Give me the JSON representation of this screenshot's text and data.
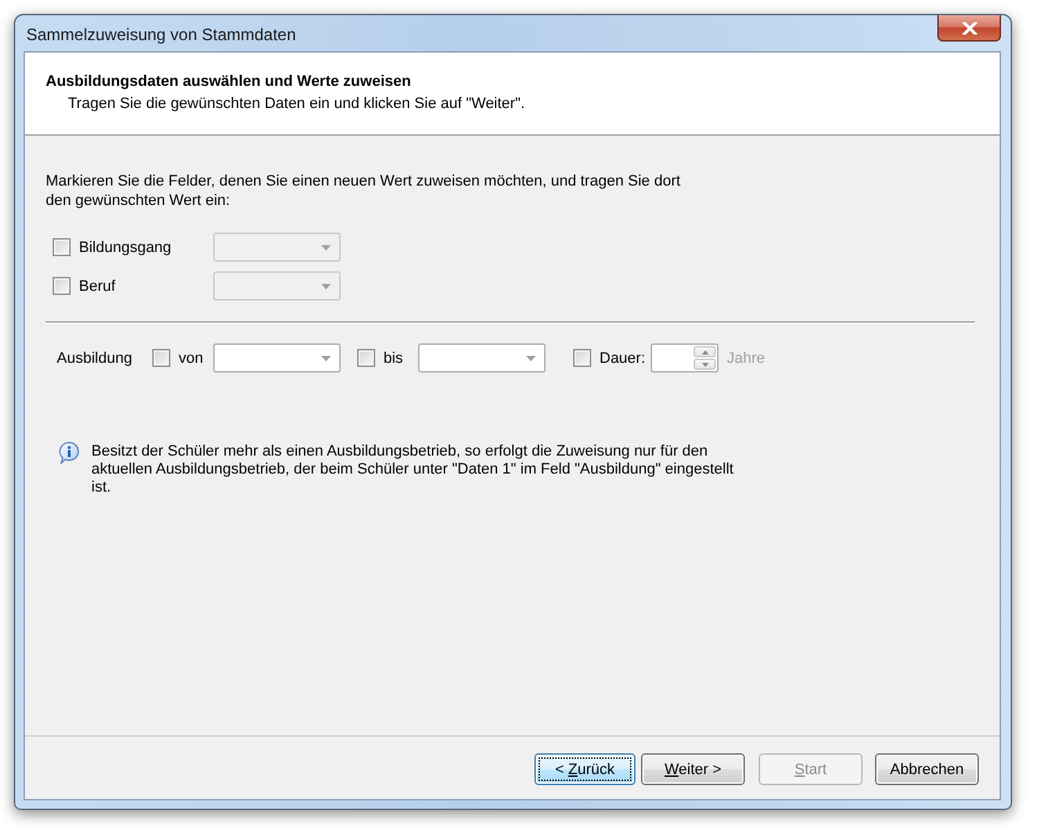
{
  "window": {
    "title": "Sammelzuweisung von Stammdaten"
  },
  "header": {
    "title": "Ausbildungsdaten auswählen und Werte zuweisen",
    "subtitle": "Tragen Sie die gewünschten Daten ein und klicken Sie auf \"Weiter\"."
  },
  "instructions": "Markieren Sie die Felder, denen Sie einen neuen Wert zuweisen möchten, und tragen Sie dort den gewünschten Wert ein:",
  "fields": [
    {
      "label": "Bildungsgang",
      "checked": false,
      "disabled": true
    },
    {
      "label": "Beruf",
      "checked": false,
      "disabled": true
    }
  ],
  "ausbildung": {
    "label": "Ausbildung",
    "items": [
      {
        "kind": "combo",
        "label": "von",
        "checked": false,
        "disabled": false
      },
      {
        "kind": "combo",
        "label": "bis",
        "checked": false,
        "disabled": false
      },
      {
        "kind": "spinner",
        "label": "Dauer:",
        "checked": false,
        "disabled": false,
        "unit": "Jahre"
      }
    ]
  },
  "info": "Besitzt der Schüler mehr als einen Ausbildungsbetrieb, so erfolgt die Zuweisung nur für den aktuellen Ausbildungsbetrieb, der beim Schüler unter \"Daten 1\" im Feld \"Ausbildung\" eingestellt ist.",
  "buttons": [
    {
      "label_parts": [
        {
          "text": "< ",
          "underlined": false
        },
        {
          "text": "Z",
          "underlined": true
        },
        {
          "text": "urück",
          "underlined": false
        }
      ],
      "focused": true,
      "disabled": false
    },
    {
      "label_parts": [
        {
          "text": "W",
          "underlined": true
        },
        {
          "text": "eiter >",
          "underlined": false
        }
      ],
      "focused": false,
      "disabled": false
    },
    {
      "label_parts": [
        {
          "text": "S",
          "underlined": true
        },
        {
          "text": "tart",
          "underlined": false
        }
      ],
      "focused": false,
      "disabled": true
    },
    {
      "label_parts": [
        {
          "text": "Abbrechen",
          "underlined": false
        }
      ],
      "focused": false,
      "disabled": false
    }
  ]
}
